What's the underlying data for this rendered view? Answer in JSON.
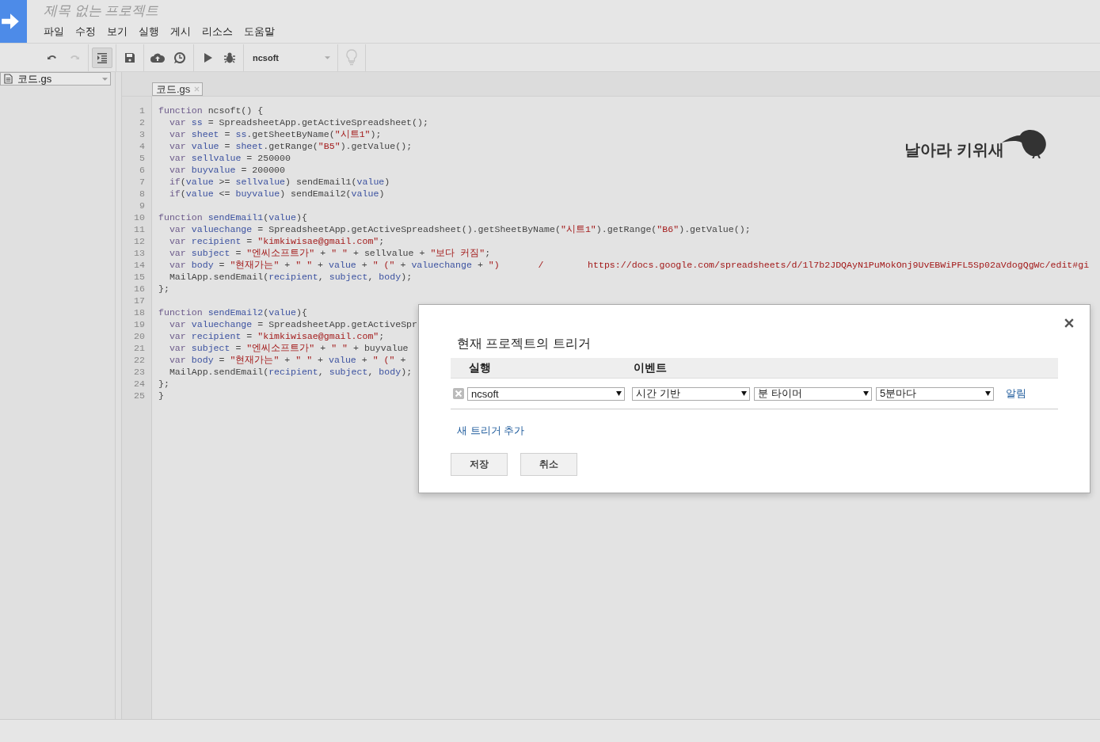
{
  "header": {
    "project_title": "제목 없는 프로젝트",
    "menu": [
      "파일",
      "수정",
      "보기",
      "실행",
      "게시",
      "리소스",
      "도움말"
    ]
  },
  "toolbar": {
    "buttons": [
      {
        "kind": "undo",
        "disabled": false,
        "on": false
      },
      {
        "kind": "redo",
        "disabled": true,
        "on": false
      },
      {
        "kind": "indent",
        "disabled": false,
        "on": true
      },
      {
        "kind": "save",
        "disabled": false,
        "on": false
      },
      {
        "kind": "publish",
        "disabled": false,
        "on": false
      },
      {
        "kind": "triggers",
        "disabled": false,
        "on": false
      },
      {
        "kind": "run",
        "disabled": false,
        "on": false
      },
      {
        "kind": "debug",
        "disabled": false,
        "on": false
      }
    ],
    "function_select": "ncsoft",
    "hint_disabled": true
  },
  "sidebar": {
    "files": [
      {
        "name": "코드.gs",
        "selected": true
      }
    ]
  },
  "tabs": [
    {
      "label": "코드.gs",
      "selected": true
    }
  ],
  "code": [
    {
      "n": "1",
      "tokens": [
        {
          "kind": "keyword",
          "text": "function"
        },
        {
          "kind": "plain",
          "text": " ncsoft() {"
        }
      ]
    },
    {
      "n": "2",
      "tokens": [
        {
          "kind": "keyword",
          "text": "  var"
        },
        {
          "kind": "variable",
          "text": " ss"
        },
        {
          "kind": "plain",
          "text": " = SpreadsheetApp.getActiveSpreadsheet();"
        }
      ]
    },
    {
      "n": "3",
      "tokens": [
        {
          "kind": "keyword",
          "text": "  var"
        },
        {
          "kind": "variable",
          "text": " sheet"
        },
        {
          "kind": "plain",
          "text": " = "
        },
        {
          "kind": "variable",
          "text": "ss"
        },
        {
          "kind": "plain",
          "text": ".getSheetByName("
        },
        {
          "kind": "string",
          "text": "\"시트1\""
        },
        {
          "kind": "plain",
          "text": ");"
        }
      ]
    },
    {
      "n": "4",
      "tokens": [
        {
          "kind": "keyword",
          "text": "  var"
        },
        {
          "kind": "variable",
          "text": " value"
        },
        {
          "kind": "plain",
          "text": " = "
        },
        {
          "kind": "variable",
          "text": "sheet"
        },
        {
          "kind": "plain",
          "text": ".getRange("
        },
        {
          "kind": "string",
          "text": "\"B5\""
        },
        {
          "kind": "plain",
          "text": ").getValue();"
        }
      ]
    },
    {
      "n": "5",
      "tokens": [
        {
          "kind": "keyword",
          "text": "  var"
        },
        {
          "kind": "variable",
          "text": " sellvalue"
        },
        {
          "kind": "plain",
          "text": " = 250000"
        }
      ]
    },
    {
      "n": "6",
      "tokens": [
        {
          "kind": "keyword",
          "text": "  var"
        },
        {
          "kind": "variable",
          "text": " buyvalue"
        },
        {
          "kind": "plain",
          "text": " = 200000"
        }
      ]
    },
    {
      "n": "7",
      "tokens": [
        {
          "kind": "keyword",
          "text": "  if"
        },
        {
          "kind": "plain",
          "text": "("
        },
        {
          "kind": "variable",
          "text": "value"
        },
        {
          "kind": "plain",
          "text": " >= "
        },
        {
          "kind": "variable",
          "text": "sellvalue"
        },
        {
          "kind": "plain",
          "text": ") sendEmail1("
        },
        {
          "kind": "variable",
          "text": "value"
        },
        {
          "kind": "plain",
          "text": ")"
        }
      ]
    },
    {
      "n": "8",
      "tokens": [
        {
          "kind": "keyword",
          "text": "  if"
        },
        {
          "kind": "plain",
          "text": "("
        },
        {
          "kind": "variable",
          "text": "value"
        },
        {
          "kind": "plain",
          "text": " <= "
        },
        {
          "kind": "variable",
          "text": "buyvalue"
        },
        {
          "kind": "plain",
          "text": ") sendEmail2("
        },
        {
          "kind": "variable",
          "text": "value"
        },
        {
          "kind": "plain",
          "text": ")"
        }
      ]
    },
    {
      "n": "9"
    },
    {
      "n": "10",
      "tokens": [
        {
          "kind": "keyword",
          "text": "function"
        },
        {
          "kind": "variable",
          "text": " sendEmail1"
        },
        {
          "kind": "plain",
          "text": "("
        },
        {
          "kind": "variable",
          "text": "value"
        },
        {
          "kind": "plain",
          "text": "){"
        }
      ]
    },
    {
      "n": "11",
      "tokens": [
        {
          "kind": "keyword",
          "text": "  var"
        },
        {
          "kind": "variable",
          "text": " valuechange"
        },
        {
          "kind": "plain",
          "text": " = SpreadsheetApp.getActiveSpreadsheet().getSheetByName("
        },
        {
          "kind": "string",
          "text": "\"시트1\""
        },
        {
          "kind": "plain",
          "text": ").getRange("
        },
        {
          "kind": "string",
          "text": "\"B6\""
        },
        {
          "kind": "plain",
          "text": ").getValue();"
        }
      ]
    },
    {
      "n": "12",
      "tokens": [
        {
          "kind": "keyword",
          "text": "  var"
        },
        {
          "kind": "variable",
          "text": " recipient"
        },
        {
          "kind": "plain",
          "text": " = "
        },
        {
          "kind": "string",
          "text": "\"kimkiwisae@gmail.com\""
        },
        {
          "kind": "plain",
          "text": ";"
        }
      ]
    },
    {
      "n": "13",
      "tokens": [
        {
          "kind": "keyword",
          "text": "  var"
        },
        {
          "kind": "variable",
          "text": " subject"
        },
        {
          "kind": "plain",
          "text": " = "
        },
        {
          "kind": "string",
          "text": "\"엔씨소프트가\""
        },
        {
          "kind": "plain",
          "text": " + "
        },
        {
          "kind": "string",
          "text": "\" \""
        },
        {
          "kind": "plain",
          "text": " + sellvalue + "
        },
        {
          "kind": "string",
          "text": "\"보다 커짐\""
        },
        {
          "kind": "plain",
          "text": ";"
        }
      ]
    },
    {
      "n": "14",
      "tokens": [
        {
          "kind": "keyword",
          "text": "  var"
        },
        {
          "kind": "variable",
          "text": " body"
        },
        {
          "kind": "plain",
          "text": " = "
        },
        {
          "kind": "string",
          "text": "\"현재가는\""
        },
        {
          "kind": "plain",
          "text": " + "
        },
        {
          "kind": "string",
          "text": "\" \""
        },
        {
          "kind": "plain",
          "text": " + "
        },
        {
          "kind": "variable",
          "text": "value"
        },
        {
          "kind": "plain",
          "text": " + "
        },
        {
          "kind": "string",
          "text": "\" (\""
        },
        {
          "kind": "plain",
          "text": " + "
        },
        {
          "kind": "variable",
          "text": "valuechange"
        },
        {
          "kind": "plain",
          "text": " + "
        },
        {
          "kind": "string",
          "text": "\")       /        https://docs.google.com/spreadsheets/d/1l7b2JDQAyN1PuMokOnj9UvEBWiPFL5Sp02aVdogQgWc/edit#gi"
        }
      ]
    },
    {
      "n": "15",
      "tokens": [
        {
          "kind": "plain",
          "text": "  MailApp.sendEmail("
        },
        {
          "kind": "variable",
          "text": "recipient"
        },
        {
          "kind": "plain",
          "text": ", "
        },
        {
          "kind": "variable",
          "text": "subject"
        },
        {
          "kind": "plain",
          "text": ", "
        },
        {
          "kind": "variable",
          "text": "body"
        },
        {
          "kind": "plain",
          "text": ");"
        }
      ]
    },
    {
      "n": "16",
      "tokens": [
        {
          "kind": "plain",
          "text": "};"
        }
      ]
    },
    {
      "n": "17"
    },
    {
      "n": "18",
      "tokens": [
        {
          "kind": "keyword",
          "text": "function"
        },
        {
          "kind": "variable",
          "text": " sendEmail2"
        },
        {
          "kind": "plain",
          "text": "("
        },
        {
          "kind": "variable",
          "text": "value"
        },
        {
          "kind": "plain",
          "text": "){"
        }
      ]
    },
    {
      "n": "19",
      "tokens": [
        {
          "kind": "keyword",
          "text": "  var"
        },
        {
          "kind": "variable",
          "text": " valuechange"
        },
        {
          "kind": "plain",
          "text": " = SpreadsheetApp.getActiveSpr"
        }
      ]
    },
    {
      "n": "20",
      "tokens": [
        {
          "kind": "keyword",
          "text": "  var"
        },
        {
          "kind": "variable",
          "text": " recipient"
        },
        {
          "kind": "plain",
          "text": " = "
        },
        {
          "kind": "string",
          "text": "\"kimkiwisae@gmail.com\""
        },
        {
          "kind": "plain",
          "text": ";"
        }
      ]
    },
    {
      "n": "21",
      "tokens": [
        {
          "kind": "keyword",
          "text": "  var"
        },
        {
          "kind": "variable",
          "text": " subject"
        },
        {
          "kind": "plain",
          "text": " = "
        },
        {
          "kind": "string",
          "text": "\"엔씨소프트가\""
        },
        {
          "kind": "plain",
          "text": " + "
        },
        {
          "kind": "string",
          "text": "\" \""
        },
        {
          "kind": "plain",
          "text": " + buyvalue"
        }
      ]
    },
    {
      "n": "22",
      "tokens": [
        {
          "kind": "keyword",
          "text": "  var"
        },
        {
          "kind": "variable",
          "text": " body"
        },
        {
          "kind": "plain",
          "text": " = "
        },
        {
          "kind": "string",
          "text": "\"현재가는\""
        },
        {
          "kind": "plain",
          "text": " + "
        },
        {
          "kind": "string",
          "text": "\" \""
        },
        {
          "kind": "plain",
          "text": " + "
        },
        {
          "kind": "variable",
          "text": "value"
        },
        {
          "kind": "plain",
          "text": " + "
        },
        {
          "kind": "string",
          "text": "\" (\""
        },
        {
          "kind": "plain",
          "text": " +"
        }
      ]
    },
    {
      "n": "23",
      "tokens": [
        {
          "kind": "plain",
          "text": "  MailApp.sendEmail("
        },
        {
          "kind": "variable",
          "text": "recipient"
        },
        {
          "kind": "plain",
          "text": ", "
        },
        {
          "kind": "variable",
          "text": "subject"
        },
        {
          "kind": "plain",
          "text": ", "
        },
        {
          "kind": "variable",
          "text": "body"
        },
        {
          "kind": "plain",
          "text": ");"
        }
      ]
    },
    {
      "n": "24",
      "tokens": [
        {
          "kind": "plain",
          "text": "};"
        }
      ]
    },
    {
      "n": "25",
      "tokens": [
        {
          "kind": "plain",
          "text": "}"
        }
      ]
    }
  ],
  "logo": {
    "text": "날아라 키위새"
  },
  "dialog": {
    "title": "현재 프로젝트의 트리거",
    "columns": [
      "실행",
      "이벤트"
    ],
    "triggers": [
      {
        "function": "ncsoft",
        "event_source": "시간 기반",
        "timer_type": "분 타이머",
        "interval": "5분마다",
        "notify_link": "알림"
      }
    ],
    "add_link": "새 트리거 추가",
    "buttons": [
      "저장",
      "취소"
    ]
  }
}
